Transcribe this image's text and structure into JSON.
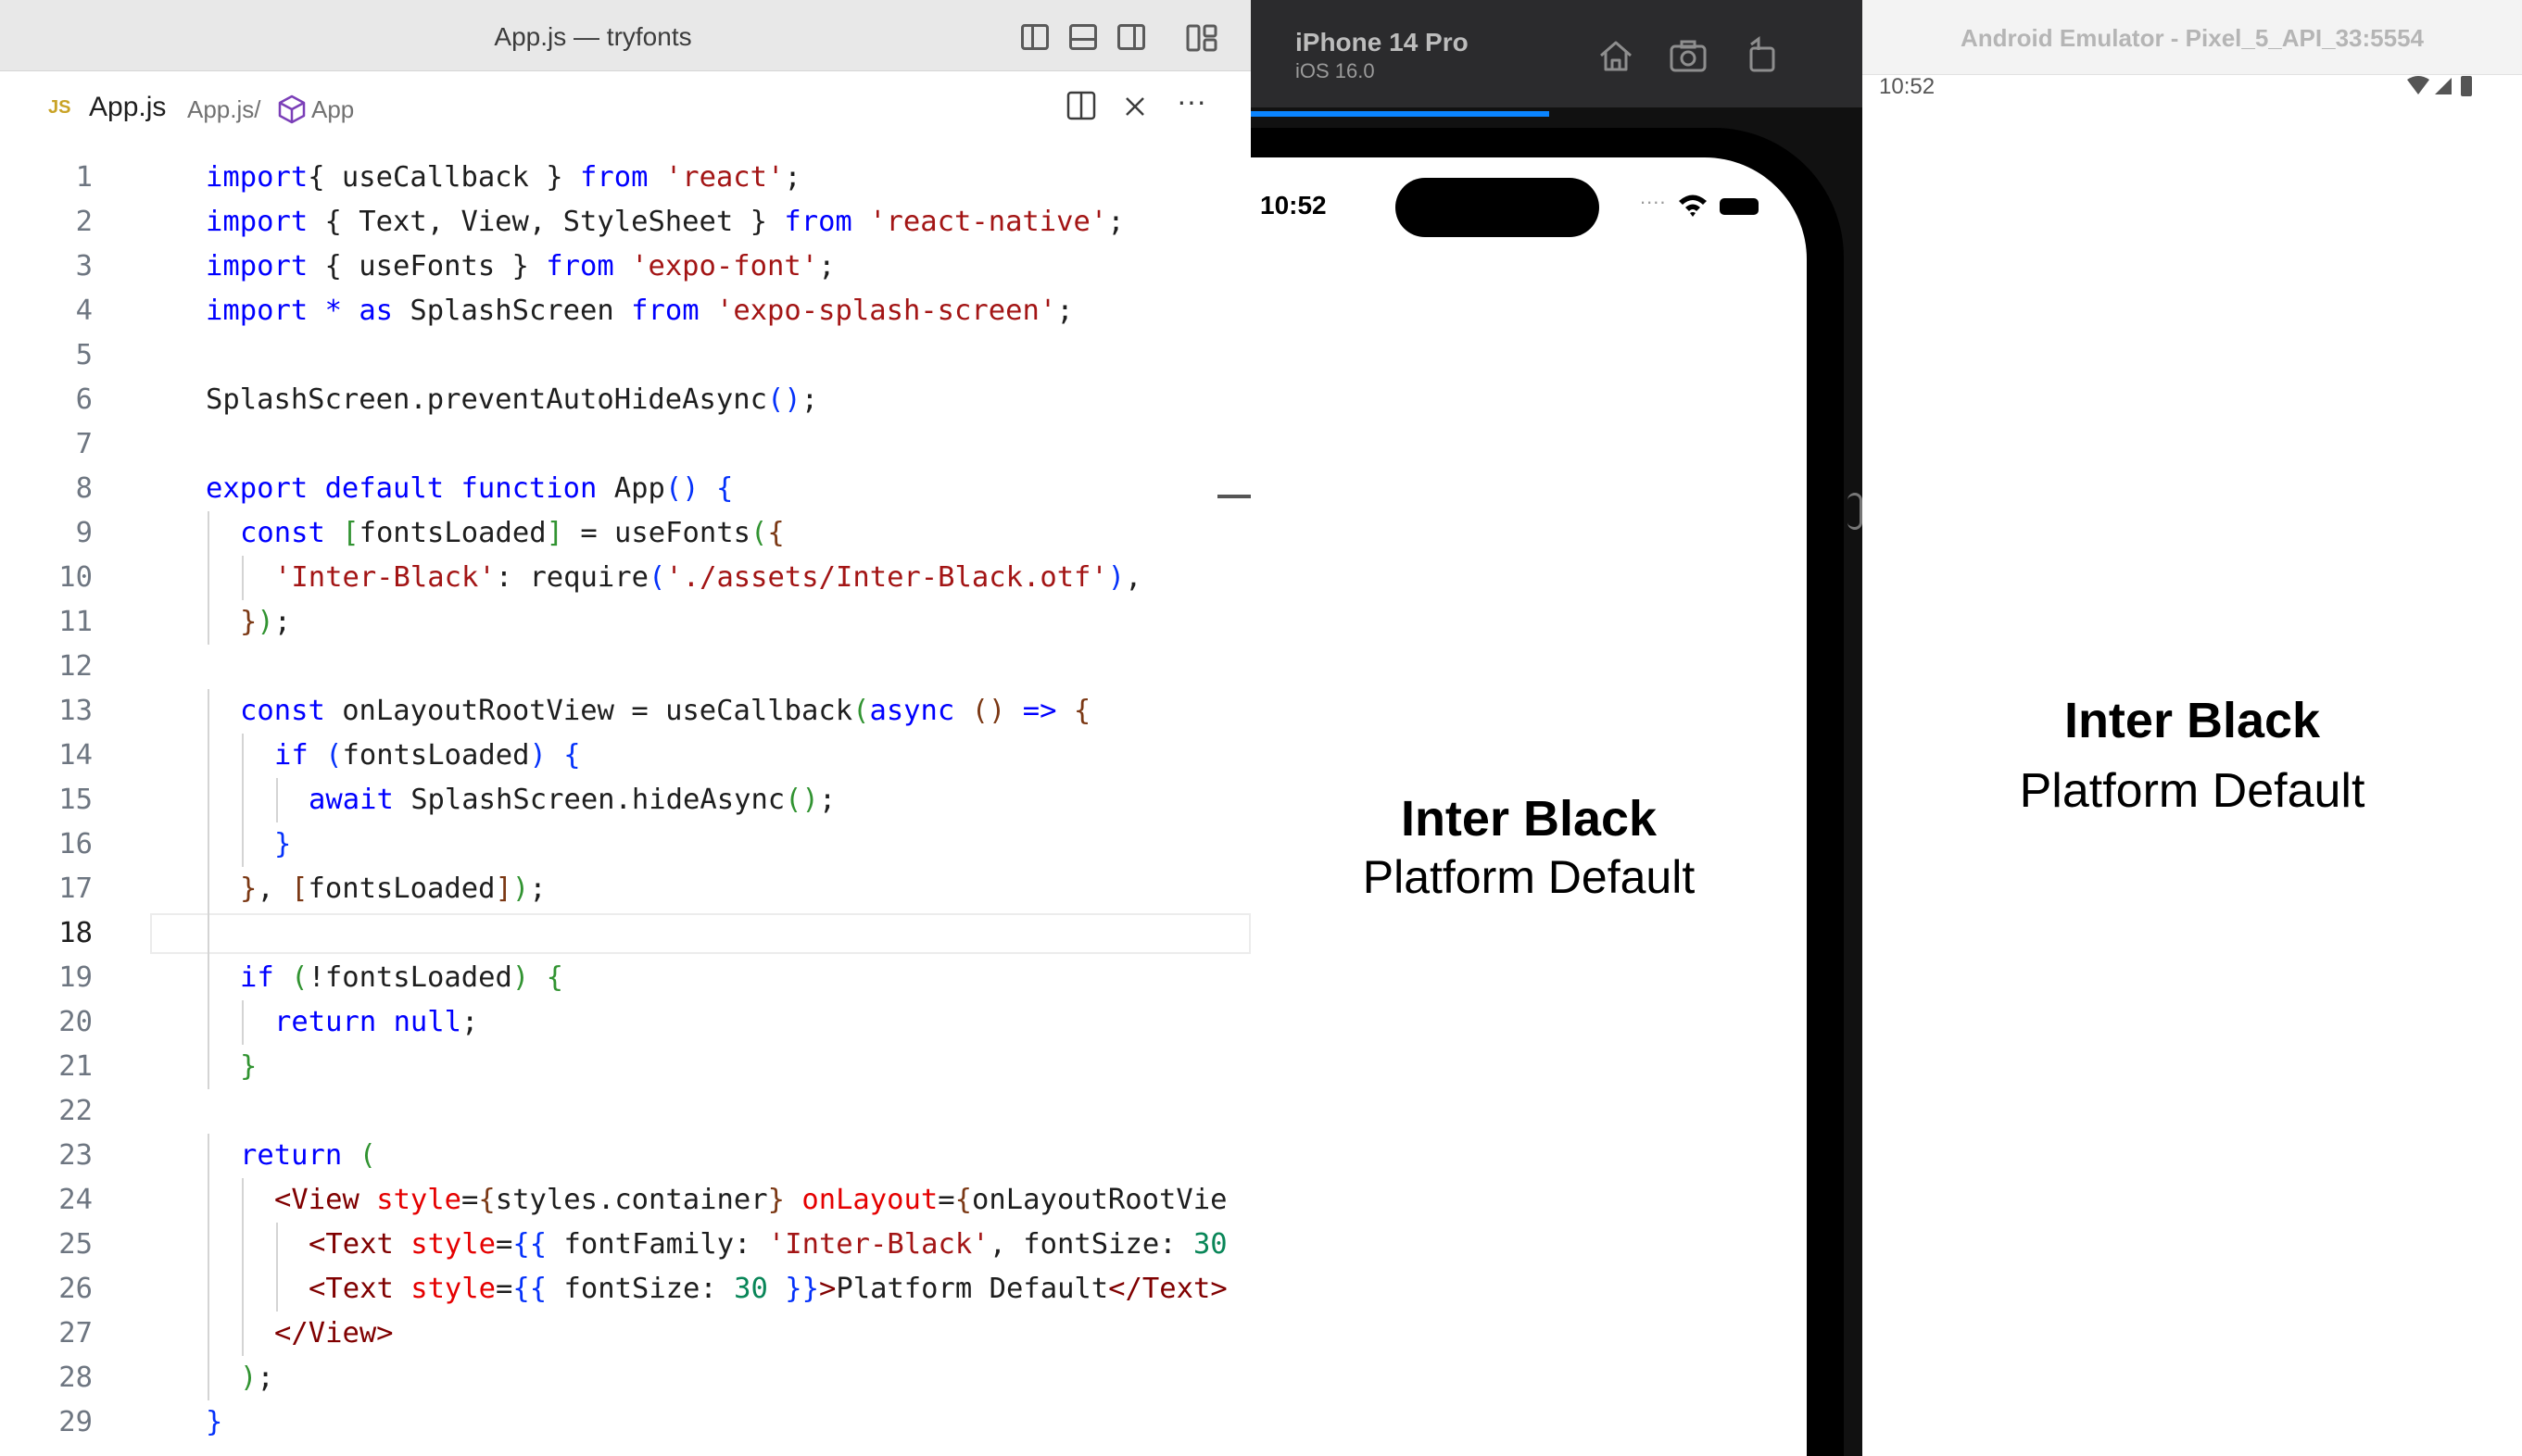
{
  "vscode": {
    "window_title": "App.js — tryfonts",
    "tab": {
      "badge": "JS",
      "filename": "App.js",
      "breadcrumb_file": "App.js/",
      "breadcrumb_symbol": "App",
      "more_label": "···"
    },
    "active_line": 18,
    "lines": [
      {
        "n": "1",
        "indent": 0,
        "tokens": [
          [
            "kw",
            "import"
          ],
          [
            "",
            "{ "
          ],
          [
            "",
            "useCallback"
          ],
          [
            "",
            " } "
          ],
          [
            "kw",
            "from"
          ],
          [
            "",
            " "
          ],
          [
            "str",
            "'react'"
          ],
          [
            "",
            ";"
          ]
        ]
      },
      {
        "n": "2",
        "indent": 0,
        "tokens": [
          [
            "kw",
            "import"
          ],
          [
            "",
            " { Text, View, StyleSheet } "
          ],
          [
            "kw",
            "from"
          ],
          [
            "",
            " "
          ],
          [
            "str",
            "'react-native'"
          ],
          [
            "",
            ";"
          ]
        ]
      },
      {
        "n": "3",
        "indent": 0,
        "tokens": [
          [
            "kw",
            "import"
          ],
          [
            "",
            " { useFonts } "
          ],
          [
            "kw",
            "from"
          ],
          [
            "",
            " "
          ],
          [
            "str",
            "'expo-font'"
          ],
          [
            "",
            ";"
          ]
        ]
      },
      {
        "n": "4",
        "indent": 0,
        "tokens": [
          [
            "kw",
            "import"
          ],
          [
            "",
            " "
          ],
          [
            "kw",
            "*"
          ],
          [
            "",
            " "
          ],
          [
            "kw",
            "as"
          ],
          [
            "",
            " SplashScreen "
          ],
          [
            "kw",
            "from"
          ],
          [
            "",
            " "
          ],
          [
            "str",
            "'expo-splash-screen'"
          ],
          [
            "",
            ";"
          ]
        ]
      },
      {
        "n": "5",
        "indent": 0,
        "tokens": []
      },
      {
        "n": "6",
        "indent": 0,
        "tokens": [
          [
            "",
            "SplashScreen.preventAutoHideAsync"
          ],
          [
            "b1",
            "()"
          ],
          [
            "",
            ";"
          ]
        ]
      },
      {
        "n": "7",
        "indent": 0,
        "tokens": []
      },
      {
        "n": "8",
        "indent": 0,
        "tokens": [
          [
            "kw",
            "export"
          ],
          [
            "",
            " "
          ],
          [
            "kw",
            "default"
          ],
          [
            "",
            " "
          ],
          [
            "kw",
            "function"
          ],
          [
            "",
            " App"
          ],
          [
            "b1",
            "()"
          ],
          [
            "",
            " "
          ],
          [
            "b1",
            "{"
          ]
        ]
      },
      {
        "n": "9",
        "indent": 1,
        "tokens": [
          [
            "kw",
            "const"
          ],
          [
            "",
            " "
          ],
          [
            "b2",
            "["
          ],
          [
            "",
            "fontsLoaded"
          ],
          [
            "b2",
            "]"
          ],
          [
            "",
            " = useFonts"
          ],
          [
            "b2",
            "("
          ],
          [
            "b3",
            "{"
          ]
        ]
      },
      {
        "n": "10",
        "indent": 2,
        "tokens": [
          [
            "str",
            "'Inter-Black'"
          ],
          [
            "",
            ": require"
          ],
          [
            "b1",
            "("
          ],
          [
            "str",
            "'./assets/Inter-Black.otf'"
          ],
          [
            "b1",
            ")"
          ],
          [
            "",
            ","
          ]
        ]
      },
      {
        "n": "11",
        "indent": 1,
        "tokens": [
          [
            "b3",
            "}"
          ],
          [
            "b2",
            ")"
          ],
          [
            "",
            ";"
          ]
        ]
      },
      {
        "n": "12",
        "indent": 0,
        "tokens": []
      },
      {
        "n": "13",
        "indent": 1,
        "tokens": [
          [
            "kw",
            "const"
          ],
          [
            "",
            " onLayoutRootView = useCallback"
          ],
          [
            "b2",
            "("
          ],
          [
            "kw",
            "async"
          ],
          [
            "",
            " "
          ],
          [
            "b3",
            "()"
          ],
          [
            "",
            " "
          ],
          [
            "kw",
            "=>"
          ],
          [
            "",
            " "
          ],
          [
            "b3",
            "{"
          ]
        ]
      },
      {
        "n": "14",
        "indent": 2,
        "tokens": [
          [
            "kw",
            "if"
          ],
          [
            "",
            " "
          ],
          [
            "b1",
            "("
          ],
          [
            "",
            "fontsLoaded"
          ],
          [
            "b1",
            ")"
          ],
          [
            "",
            " "
          ],
          [
            "b1",
            "{"
          ]
        ]
      },
      {
        "n": "15",
        "indent": 3,
        "tokens": [
          [
            "kw",
            "await"
          ],
          [
            "",
            " SplashScreen.hideAsync"
          ],
          [
            "b2",
            "()"
          ],
          [
            "",
            ";"
          ]
        ]
      },
      {
        "n": "16",
        "indent": 2,
        "tokens": [
          [
            "b1",
            "}"
          ]
        ]
      },
      {
        "n": "17",
        "indent": 1,
        "tokens": [
          [
            "b3",
            "}"
          ],
          [
            "",
            ", "
          ],
          [
            "b3",
            "["
          ],
          [
            "",
            "fontsLoaded"
          ],
          [
            "b3",
            "]"
          ],
          [
            "b2",
            ")"
          ],
          [
            "",
            ";"
          ]
        ]
      },
      {
        "n": "18",
        "indent": 1,
        "tokens": []
      },
      {
        "n": "19",
        "indent": 1,
        "tokens": [
          [
            "kw",
            "if"
          ],
          [
            "",
            " "
          ],
          [
            "b2",
            "("
          ],
          [
            "",
            "!fontsLoaded"
          ],
          [
            "b2",
            ")"
          ],
          [
            "",
            " "
          ],
          [
            "b2",
            "{"
          ]
        ]
      },
      {
        "n": "20",
        "indent": 2,
        "tokens": [
          [
            "kw",
            "return"
          ],
          [
            "",
            " "
          ],
          [
            "kw",
            "null"
          ],
          [
            "",
            ";"
          ]
        ]
      },
      {
        "n": "21",
        "indent": 1,
        "tokens": [
          [
            "b2",
            "}"
          ]
        ]
      },
      {
        "n": "22",
        "indent": 0,
        "tokens": []
      },
      {
        "n": "23",
        "indent": 1,
        "tokens": [
          [
            "kw",
            "return"
          ],
          [
            "",
            " "
          ],
          [
            "b2",
            "("
          ]
        ]
      },
      {
        "n": "24",
        "indent": 2,
        "tokens": [
          [
            "tag",
            "<View"
          ],
          [
            "",
            " "
          ],
          [
            "attr",
            "style"
          ],
          [
            "",
            "="
          ],
          [
            "b3",
            "{"
          ],
          [
            "",
            "styles.container"
          ],
          [
            "b3",
            "}"
          ],
          [
            "",
            " "
          ],
          [
            "attr",
            "onLayout"
          ],
          [
            "",
            "="
          ],
          [
            "b3",
            "{"
          ],
          [
            "",
            "onLayoutRootVie"
          ]
        ]
      },
      {
        "n": "25",
        "indent": 3,
        "tokens": [
          [
            "tag",
            "<Text"
          ],
          [
            "",
            " "
          ],
          [
            "attr",
            "style"
          ],
          [
            "",
            "="
          ],
          [
            "b1",
            "{{"
          ],
          [
            "",
            " fontFamily: "
          ],
          [
            "str",
            "'Inter-Black'"
          ],
          [
            "",
            ", fontSize: "
          ],
          [
            "num",
            "30"
          ]
        ]
      },
      {
        "n": "26",
        "indent": 3,
        "tokens": [
          [
            "tag",
            "<Text"
          ],
          [
            "",
            " "
          ],
          [
            "attr",
            "style"
          ],
          [
            "",
            "="
          ],
          [
            "b1",
            "{{"
          ],
          [
            "",
            " fontSize: "
          ],
          [
            "num",
            "30"
          ],
          [
            "",
            " "
          ],
          [
            "b1",
            "}}"
          ],
          [
            "tag",
            ">"
          ],
          [
            "",
            "Platform Default"
          ],
          [
            "tag",
            "</Text>"
          ]
        ]
      },
      {
        "n": "27",
        "indent": 2,
        "tokens": [
          [
            "tag",
            "</View>"
          ]
        ]
      },
      {
        "n": "28",
        "indent": 1,
        "tokens": [
          [
            "b2",
            ")"
          ],
          [
            "",
            ";"
          ]
        ]
      },
      {
        "n": "29",
        "indent": 0,
        "tokens": [
          [
            "b1",
            "}"
          ]
        ]
      }
    ]
  },
  "ios": {
    "device_name": "iPhone 14 Pro",
    "os_version": "iOS 16.0",
    "status_time": "10:52",
    "status_dots": "....",
    "text_inter_black": "Inter Black",
    "text_platform_default": "Platform Default"
  },
  "android": {
    "window_title": "Android Emulator - Pixel_5_API_33:5554",
    "status_time": "10:52",
    "text_inter_black": "Inter Black",
    "text_platform_default": "Platform Default"
  }
}
